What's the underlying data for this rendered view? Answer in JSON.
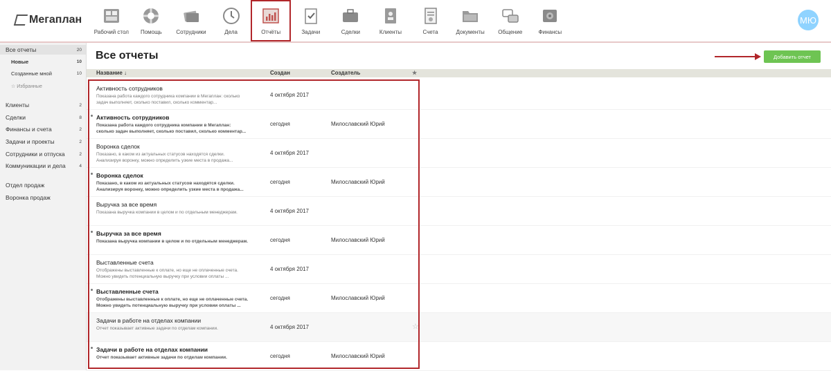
{
  "logo": {
    "text": "Мегаплан"
  },
  "avatar": {
    "initials": "МЮ"
  },
  "nav": [
    {
      "label": "Рабочий стол",
      "icon": "desktop-icon"
    },
    {
      "label": "Помощь",
      "icon": "lifebuoy-icon"
    },
    {
      "label": "Сотрудники",
      "icon": "employees-icon"
    },
    {
      "label": "Дела",
      "icon": "clock-icon"
    },
    {
      "label": "Отчёты",
      "icon": "reports-chart-icon",
      "active": true
    },
    {
      "label": "Задачи",
      "icon": "clipboard-icon"
    },
    {
      "label": "Сделки",
      "icon": "briefcase-icon"
    },
    {
      "label": "Клиенты",
      "icon": "contacts-icon"
    },
    {
      "label": "Счета",
      "icon": "invoice-icon"
    },
    {
      "label": "Документы",
      "icon": "folder-icon"
    },
    {
      "label": "Общение",
      "icon": "chat-icon"
    },
    {
      "label": "Финансы",
      "icon": "safe-icon"
    }
  ],
  "sidebar": {
    "items": [
      {
        "label": "Все отчеты",
        "count": "20",
        "type": "main",
        "selected": true
      },
      {
        "label": "Новые",
        "count": "10",
        "type": "sub-bold"
      },
      {
        "label": "Созданные мной",
        "count": "10",
        "type": "sub"
      },
      {
        "label": "Избранные",
        "count": "",
        "type": "fav"
      },
      {
        "label": "Клиенты",
        "count": "2",
        "type": "main"
      },
      {
        "label": "Сделки",
        "count": "8",
        "type": "main"
      },
      {
        "label": "Финансы и счета",
        "count": "2",
        "type": "main"
      },
      {
        "label": "Задачи и проекты",
        "count": "2",
        "type": "main"
      },
      {
        "label": "Сотрудники и отпуска",
        "count": "2",
        "type": "main"
      },
      {
        "label": "Коммуникации и дела",
        "count": "4",
        "type": "main"
      },
      {
        "label": "Отдел продаж",
        "count": "",
        "type": "main"
      },
      {
        "label": "Воронка продаж",
        "count": "",
        "type": "main"
      }
    ]
  },
  "main": {
    "title": "Все отчеты",
    "add_button": "Добавить отчет",
    "columns": {
      "name": "Название ↓",
      "created": "Создан",
      "creator": "Создатель"
    },
    "rows": [
      {
        "name": "Активность сотрудников",
        "desc": "Показана работа каждого сотрудника компании в Мегаплан: сколько задач выполняет, сколько поставил, сколько комментар...",
        "created": "4 октября 2017",
        "creator": "",
        "bold": false
      },
      {
        "name": "Активность сотрудников",
        "desc": "Показана работа каждого сотрудника компании в Мегаплан: сколько задач выполняет, сколько поставил, сколько комментар...",
        "created": "сегодня",
        "creator": "Милославский Юрий",
        "bold": true
      },
      {
        "name": "Воронка сделок",
        "desc": "Показано, в каком из актуальных статусов находятся сделки. Анализируя воронку, можно определить узкие места в продажа...",
        "created": "4 октября 2017",
        "creator": "",
        "bold": false
      },
      {
        "name": "Воронка сделок",
        "desc": "Показано, в каком из актуальных статусов находятся сделки. Анализируя воронку, можно определить узкие места в продажа...",
        "created": "сегодня",
        "creator": "Милославский Юрий",
        "bold": true
      },
      {
        "name": "Выручка за все время",
        "desc": "Показана выручка компании в целом и по отдельным менеджерам.",
        "created": "4 октября 2017",
        "creator": "",
        "bold": false
      },
      {
        "name": "Выручка за все время",
        "desc": "Показана выручка компании в целом и по отдельным менеджерам.",
        "created": "сегодня",
        "creator": "Милославский Юрий",
        "bold": true
      },
      {
        "name": "Выставленные счета",
        "desc": "Отображены выставленные к оплате, но еще не оплаченные счета. Можно увидеть потенциальную выручку при условии оплаты ...",
        "created": "4 октября 2017",
        "creator": "",
        "bold": false
      },
      {
        "name": "Выставленные счета",
        "desc": "Отображены выставленные к оплате, но еще не оплаченные счета. Можно увидеть потенциальную выручку при условии оплаты ...",
        "created": "сегодня",
        "creator": "Милославский Юрий",
        "bold": true
      },
      {
        "name": "Задачи в работе на отделах компании",
        "desc": "Отчет показывает активные задачи по отделам компании.",
        "created": "4 октября 2017",
        "creator": "",
        "bold": false,
        "highlight": true
      },
      {
        "name": "Задачи в работе на отделах компании",
        "desc": "Отчет показывает активные задачи по отделам компании.",
        "created": "сегодня",
        "creator": "Милославский Юрий",
        "bold": true
      }
    ]
  },
  "colors": {
    "accent_red": "#b1262a",
    "button_green": "#6ec453"
  }
}
